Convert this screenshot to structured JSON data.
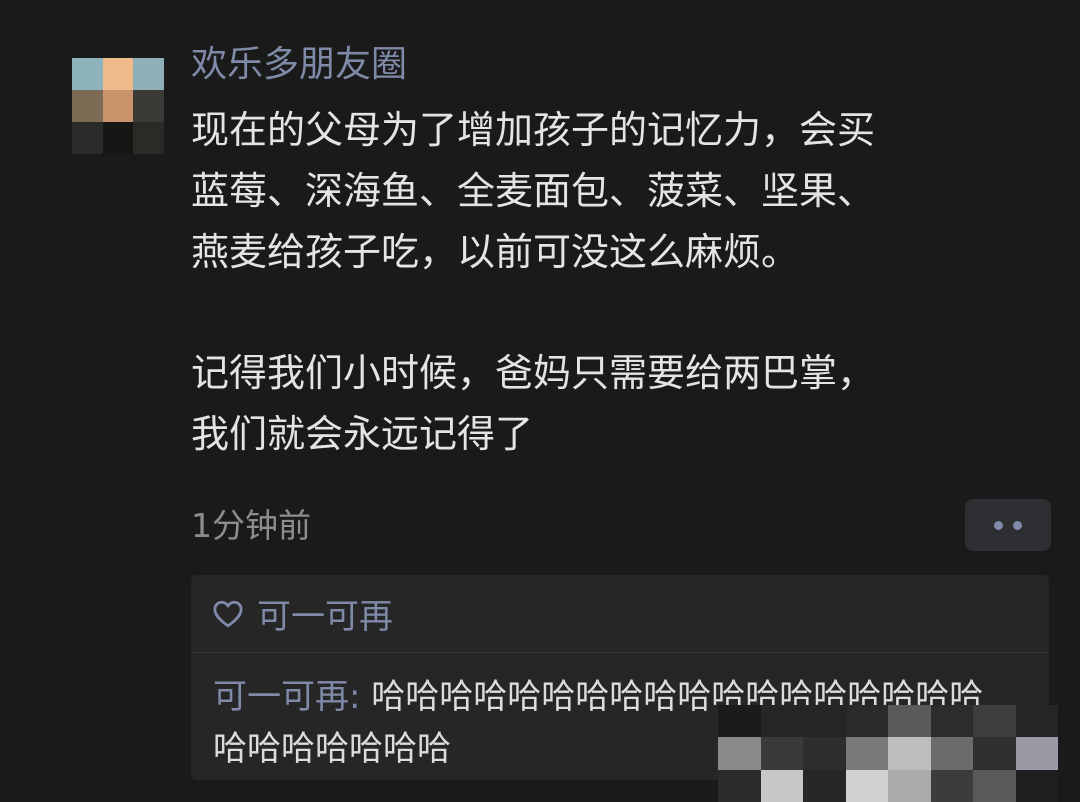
{
  "post": {
    "username": "欢乐多朋友圈",
    "lines": [
      "现在的父母为了增加孩子的记忆力，会买",
      "蓝莓、深海鱼、全麦面包、菠菜、坚果、",
      "燕麦给孩子吃，以前可没这么麻烦。"
    ],
    "lines2": [
      "记得我们小时候，爸妈只需要给两巴掌，",
      "我们就会永远记得了"
    ],
    "time": "1分钟前"
  },
  "likes": {
    "icon": "heart-outline-icon",
    "names": "可一可再"
  },
  "comment": {
    "author": "可一可再",
    "separator": ": ",
    "text": "哈哈哈哈哈哈哈哈哈哈哈哈哈哈哈哈哈哈哈哈哈哈哈哈哈"
  },
  "colors": {
    "background": "#1a1a1a",
    "name_link": "#7e8aa8",
    "body_text": "#e4e4e4",
    "timestamp": "#8d8d8d",
    "panel": "#262626"
  }
}
